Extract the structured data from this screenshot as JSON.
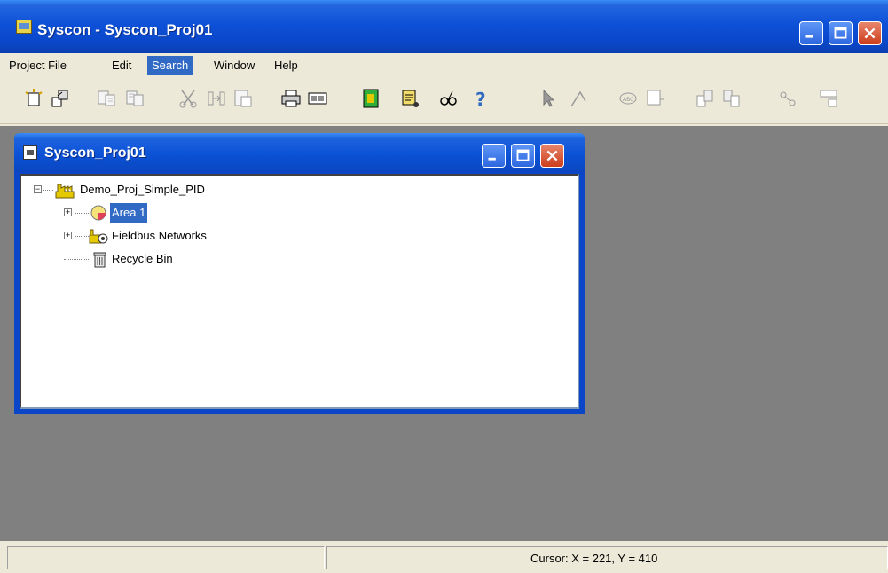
{
  "window": {
    "title": "Syscon - Syscon_Proj01"
  },
  "menu": {
    "items": [
      {
        "label": "Project File"
      },
      {
        "label": "Edit"
      },
      {
        "label": "Search",
        "active": true
      },
      {
        "label": "Window"
      },
      {
        "label": "Help"
      }
    ]
  },
  "toolbar": {
    "buttons": [
      {
        "name": "new-icon"
      },
      {
        "name": "open-icon"
      },
      {
        "name": "save-icon"
      },
      {
        "name": "save-all-icon"
      },
      {
        "name": "cut-icon"
      },
      {
        "name": "copy-icon"
      },
      {
        "name": "paste-icon"
      },
      {
        "name": "print-icon"
      },
      {
        "name": "print-preview-icon"
      },
      {
        "name": "export-icon"
      },
      {
        "name": "script-icon"
      },
      {
        "name": "view-icon"
      },
      {
        "name": "help-icon"
      },
      {
        "name": "pointer-icon"
      },
      {
        "name": "link-icon"
      },
      {
        "name": "tag-icon"
      },
      {
        "name": "block-icon"
      },
      {
        "name": "upload-icon"
      },
      {
        "name": "download-icon"
      },
      {
        "name": "network-icon"
      },
      {
        "name": "config-icon"
      }
    ]
  },
  "child_window": {
    "title": "Syscon_Proj01",
    "tree": {
      "root": "Demo_Proj_Simple_PID",
      "children": [
        {
          "label": "Area 1",
          "selected": true
        },
        {
          "label": "Fieldbus Networks"
        },
        {
          "label": "Recycle Bin"
        }
      ]
    }
  },
  "statusbar": {
    "cursor_text": "Cursor: X = 221, Y = 410"
  },
  "colors": {
    "titlebar": "#0b52d6",
    "selection": "#316ac5",
    "mdi_background": "#808080"
  }
}
